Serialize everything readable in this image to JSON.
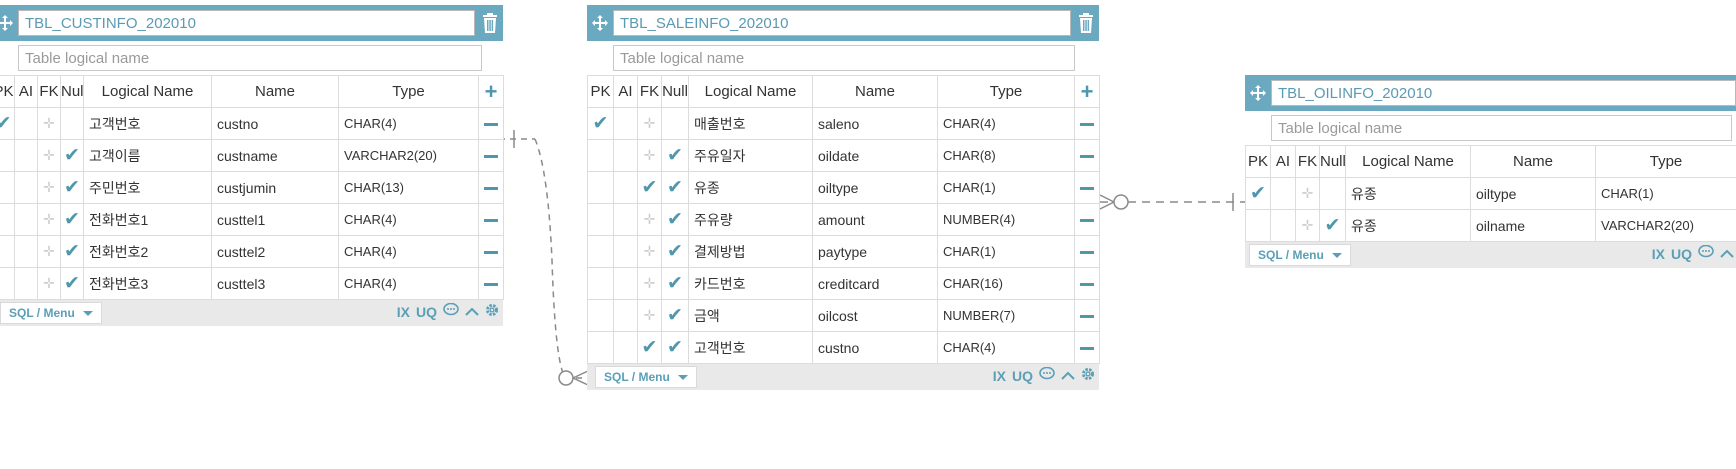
{
  "headers": {
    "pk": "PK",
    "ai": "AI",
    "fk": "FK",
    "null": "Null",
    "logical": "Logical Name",
    "name": "Name",
    "type": "Type"
  },
  "logical_placeholder": "Table logical name",
  "footer": {
    "sql_label": "SQL / Menu",
    "ix": "IX",
    "uq": "UQ"
  },
  "icons": {
    "move": "move-icon",
    "trash": "trash-icon",
    "check": "check-icon",
    "grip": "grip-icon",
    "minus": "minus-icon",
    "plus": "plus-icon",
    "comment": "comment-icon",
    "collapse": "chevron-up-icon",
    "settings": "gear-icon",
    "caret": "caret-down-icon"
  },
  "colors": {
    "accent": "#6aa9bf",
    "check": "#4f97ad",
    "panel": "#e9e9e9"
  },
  "tables": [
    {
      "name": "TBL_CUSTINFO_202010",
      "rows": [
        {
          "pk": true,
          "fk": false,
          "nn": false,
          "logical": "고객번호",
          "name": "custno",
          "type": "CHAR(4)"
        },
        {
          "pk": false,
          "fk": false,
          "nn": true,
          "logical": "고객이름",
          "name": "custname",
          "type": "VARCHAR2(20)"
        },
        {
          "pk": false,
          "fk": false,
          "nn": true,
          "logical": "주민번호",
          "name": "custjumin",
          "type": "CHAR(13)"
        },
        {
          "pk": false,
          "fk": false,
          "nn": true,
          "logical": "전화번호1",
          "name": "custtel1",
          "type": "CHAR(4)"
        },
        {
          "pk": false,
          "fk": false,
          "nn": true,
          "logical": "전화번호2",
          "name": "custtel2",
          "type": "CHAR(4)"
        },
        {
          "pk": false,
          "fk": false,
          "nn": true,
          "logical": "전화번호3",
          "name": "custtel3",
          "type": "CHAR(4)"
        }
      ]
    },
    {
      "name": "TBL_SALEINFO_202010",
      "rows": [
        {
          "pk": true,
          "fk": false,
          "nn": false,
          "logical": "매출번호",
          "name": "saleno",
          "type": "CHAR(4)"
        },
        {
          "pk": false,
          "fk": false,
          "nn": true,
          "logical": "주유일자",
          "name": "oildate",
          "type": "CHAR(8)"
        },
        {
          "pk": false,
          "fk": true,
          "nn": true,
          "logical": "유종",
          "name": "oiltype",
          "type": "CHAR(1)"
        },
        {
          "pk": false,
          "fk": false,
          "nn": true,
          "logical": "주유량",
          "name": "amount",
          "type": "NUMBER(4)"
        },
        {
          "pk": false,
          "fk": false,
          "nn": true,
          "logical": "결제방법",
          "name": "paytype",
          "type": "CHAR(1)"
        },
        {
          "pk": false,
          "fk": false,
          "nn": true,
          "logical": "카드번호",
          "name": "creditcard",
          "type": "CHAR(16)"
        },
        {
          "pk": false,
          "fk": false,
          "nn": true,
          "logical": "금액",
          "name": "oilcost",
          "type": "NUMBER(7)"
        },
        {
          "pk": false,
          "fk": true,
          "nn": true,
          "logical": "고객번호",
          "name": "custno",
          "type": "CHAR(4)"
        }
      ]
    },
    {
      "name": "TBL_OILINFO_202010",
      "rows": [
        {
          "pk": true,
          "fk": false,
          "nn": false,
          "logical": "유종",
          "name": "oiltype",
          "type": "CHAR(1)"
        },
        {
          "pk": false,
          "fk": false,
          "nn": true,
          "logical": "유종",
          "name": "oilname",
          "type": "VARCHAR2(20)"
        }
      ]
    }
  ]
}
